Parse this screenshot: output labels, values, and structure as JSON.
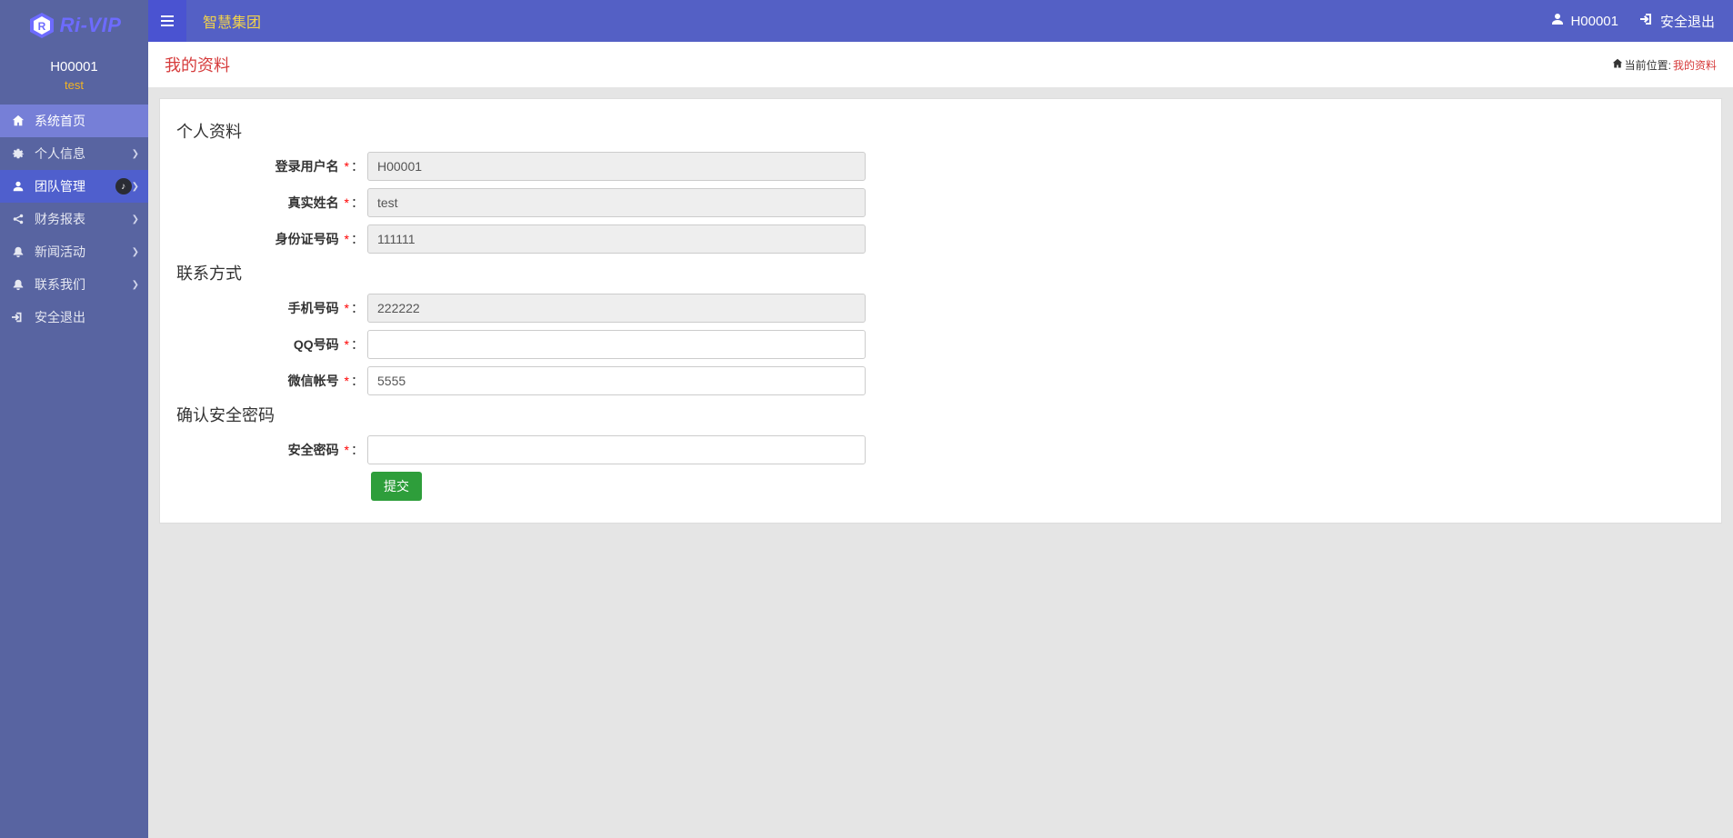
{
  "brand": {
    "text": "Ri-VIP"
  },
  "user": {
    "id": "H00001",
    "name": "test"
  },
  "topbar": {
    "title": "智慧集团",
    "user_link": "H00001",
    "logout": "安全退出"
  },
  "sidebar": {
    "items": [
      {
        "icon": "home",
        "label": "系统首页",
        "expandable": false
      },
      {
        "icon": "gear",
        "label": "个人信息",
        "expandable": true
      },
      {
        "icon": "user",
        "label": "团队管理",
        "expandable": true,
        "badge": "♪"
      },
      {
        "icon": "share",
        "label": "财务报表",
        "expandable": true
      },
      {
        "icon": "bell",
        "label": "新闻活动",
        "expandable": true
      },
      {
        "icon": "bell",
        "label": "联系我们",
        "expandable": true
      },
      {
        "icon": "exit",
        "label": "安全退出",
        "expandable": false
      }
    ]
  },
  "breadcrumb": {
    "page_title": "我的资料",
    "prefix": "当前位置:",
    "current": "我的资料"
  },
  "form": {
    "sections": {
      "personal": "个人资料",
      "contact": "联系方式",
      "confirm": "确认安全密码"
    },
    "labels": {
      "login_name": "登录用户名",
      "real_name": "真实姓名",
      "id_number": "身份证号码",
      "mobile": "手机号码",
      "qq": "QQ号码",
      "wechat": "微信帐号",
      "sec_pwd": "安全密码"
    },
    "values": {
      "login_name": "H00001",
      "real_name": "test",
      "id_number": "111111",
      "mobile": "222222",
      "qq": "",
      "wechat": "5555",
      "sec_pwd": ""
    },
    "submit": "提交",
    "required_mark": "*",
    "colon": "："
  }
}
